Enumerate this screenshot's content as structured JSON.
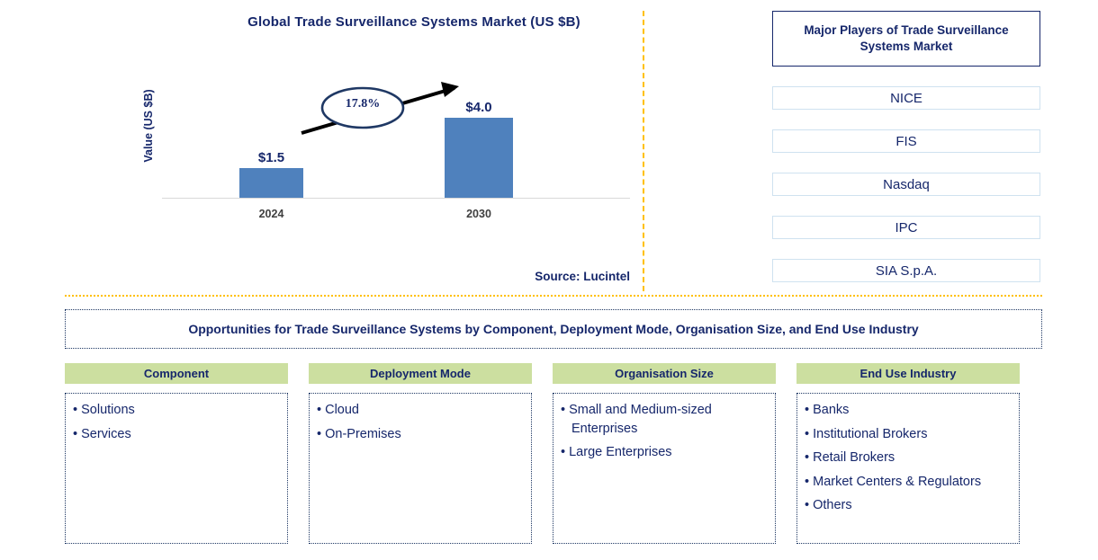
{
  "chart_panel": {
    "title": "Global Trade Surveillance Systems Market (US $B)",
    "source_note": "Source: Lucintel",
    "cagr_label": "17.8%"
  },
  "chart_data": {
    "type": "bar",
    "title": "Global Trade Surveillance Systems Market (US $B)",
    "categories": [
      "2024",
      "2030"
    ],
    "values": [
      1.5,
      4.0
    ],
    "value_labels": [
      "$1.5",
      "$4.0"
    ],
    "xlabel": "",
    "ylabel": "Value (US $B)",
    "ylim": [
      0,
      4.6
    ],
    "grid": false,
    "legend": false,
    "bar_color": "#4f81bd",
    "annotations": [
      {
        "text": "17.8%",
        "kind": "cagr-ellipse-with-arrow"
      }
    ]
  },
  "players": {
    "header": "Major Players of Trade Surveillance Systems Market",
    "items": [
      {
        "label": "NICE"
      },
      {
        "label": "FIS"
      },
      {
        "label": "Nasdaq"
      },
      {
        "label": "IPC"
      },
      {
        "label": "SIA S.p.A."
      }
    ]
  },
  "opportunities": {
    "banner": "Opportunities for Trade Surveillance Systems by Component, Deployment Mode, Organisation Size, and End Use Industry",
    "columns": [
      {
        "header": "Component",
        "items": [
          "Solutions",
          "Services"
        ]
      },
      {
        "header": "Deployment Mode",
        "items": [
          "Cloud",
          "On-Premises"
        ]
      },
      {
        "header": "Organisation Size",
        "items": [
          "Small and Medium-sized Enterprises",
          "Large Enterprises"
        ]
      },
      {
        "header": "End Use Industry",
        "items": [
          "Banks",
          "Institutional Brokers",
          "Retail Brokers",
          "Market Centers & Regulators",
          "Others"
        ]
      }
    ]
  },
  "colors": {
    "navy": "#16276b",
    "bar_blue": "#4f81bd",
    "header_green": "#ccdfa0",
    "divider_orange": "#ffc000",
    "player_border": "#cfe2f0"
  }
}
